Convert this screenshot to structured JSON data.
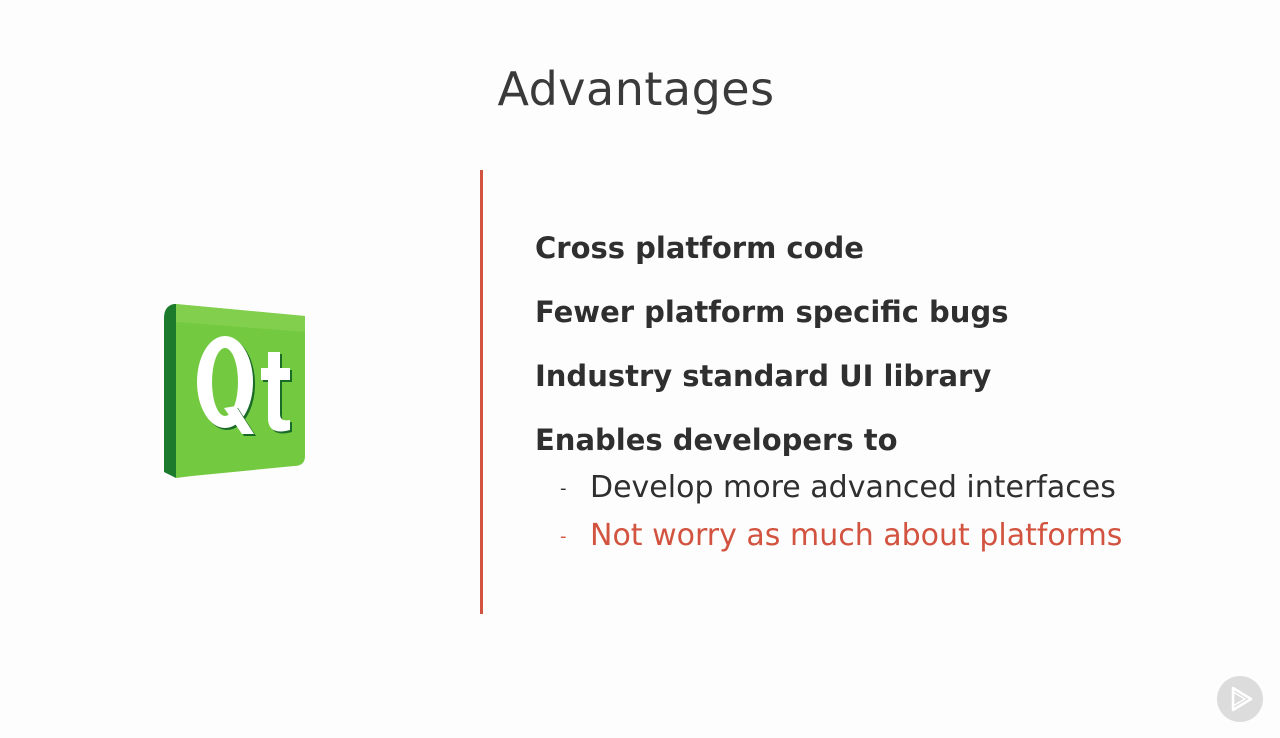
{
  "slide": {
    "title": "Advantages",
    "logo": {
      "text": "Qt",
      "icon": "qt-logo-icon",
      "color_main": "#73c940",
      "color_dark": "#1c7a2c"
    },
    "accent_color": "#d2533f",
    "bullets": [
      "Cross platform code",
      "Fewer platform specific bugs",
      "Industry standard UI library",
      "Enables developers to"
    ],
    "sub_bullets": [
      {
        "dash": "-",
        "text": "Develop more advanced interfaces"
      },
      {
        "dash": "-",
        "text": "Not worry as much about platforms"
      }
    ]
  },
  "player": {
    "icon": "play-icon"
  }
}
